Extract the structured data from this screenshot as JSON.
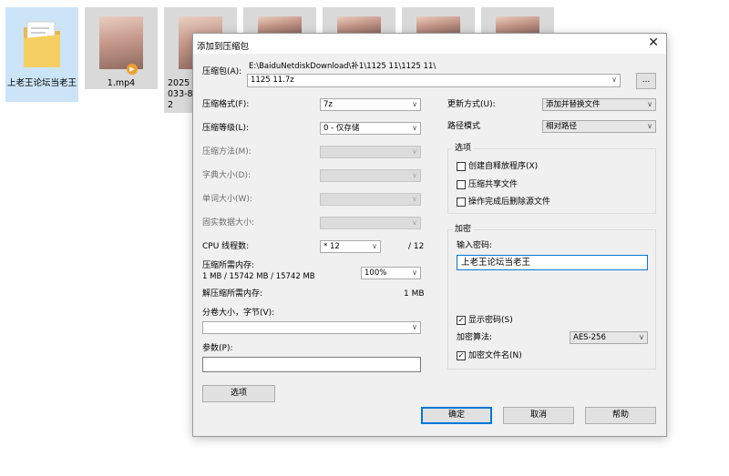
{
  "desktop": {
    "files": [
      {
        "name": "上老王论坛当老王",
        "type": "folder"
      },
      {
        "name": "1.mp4",
        "type": "video"
      },
      {
        "name": "2025033-82",
        "type": "image"
      },
      {
        "name": "",
        "type": "image"
      },
      {
        "name": "",
        "type": "image"
      },
      {
        "name": "",
        "type": "image"
      },
      {
        "name": "",
        "type": "image"
      }
    ]
  },
  "dialog": {
    "title": "添加到压缩包",
    "archive": {
      "label": "压缩包(A):",
      "path": "E:\\BaiduNetdiskDownload\\补1\\1125 11\\1125 11\\",
      "value": "1125 11.7z",
      "browse_label": "..."
    },
    "left": {
      "format": {
        "label": "压缩格式(F):",
        "value": "7z"
      },
      "level": {
        "label": "压缩等级(L):",
        "value": "0 - 仅存储"
      },
      "method": {
        "label": "压缩方法(M):",
        "value": ""
      },
      "dict": {
        "label": "字典大小(D):",
        "value": ""
      },
      "word": {
        "label": "单词大小(W):",
        "value": ""
      },
      "solid": {
        "label": "固实数据大小:",
        "value": ""
      },
      "cpu": {
        "label": "CPU 线程数:",
        "value": "* 12",
        "max": "/ 12"
      },
      "mem_comp": {
        "label": "压缩所需内存:",
        "detail": "1 MB / 15742 MB / 15742 MB",
        "value": "100%"
      },
      "mem_decomp": {
        "label": "解压缩所需内存:",
        "value": "1 MB"
      },
      "volume": {
        "label": "分卷大小，字节(V):",
        "value": ""
      },
      "params": {
        "label": "参数(P):",
        "value": ""
      },
      "options_button": "选项"
    },
    "right": {
      "update": {
        "label": "更新方式(U):",
        "value": "添加并替换文件"
      },
      "pathmode": {
        "label": "路径模式",
        "value": "相对路径"
      },
      "options": {
        "title": "选项",
        "sfx": {
          "label": "创建自释放程序(X)",
          "checked": false
        },
        "shared": {
          "label": "压缩共享文件",
          "checked": false
        },
        "delete": {
          "label": "操作完成后删除源文件",
          "checked": false
        }
      },
      "encryption": {
        "title": "加密",
        "password_label": "输入密码:",
        "password": "上老王论坛当老王",
        "show": {
          "label": "显示密码(S)",
          "checked": true
        },
        "method_label": "加密算法:",
        "method": "AES-256",
        "encrypt_names": {
          "label": "加密文件名(N)",
          "checked": true
        }
      }
    },
    "buttons": {
      "ok": "确定",
      "cancel": "取消",
      "help": "帮助"
    },
    "icons": {
      "close": "close-icon",
      "dropdown": "chevron-down-icon",
      "check": "checkmark-icon"
    }
  }
}
